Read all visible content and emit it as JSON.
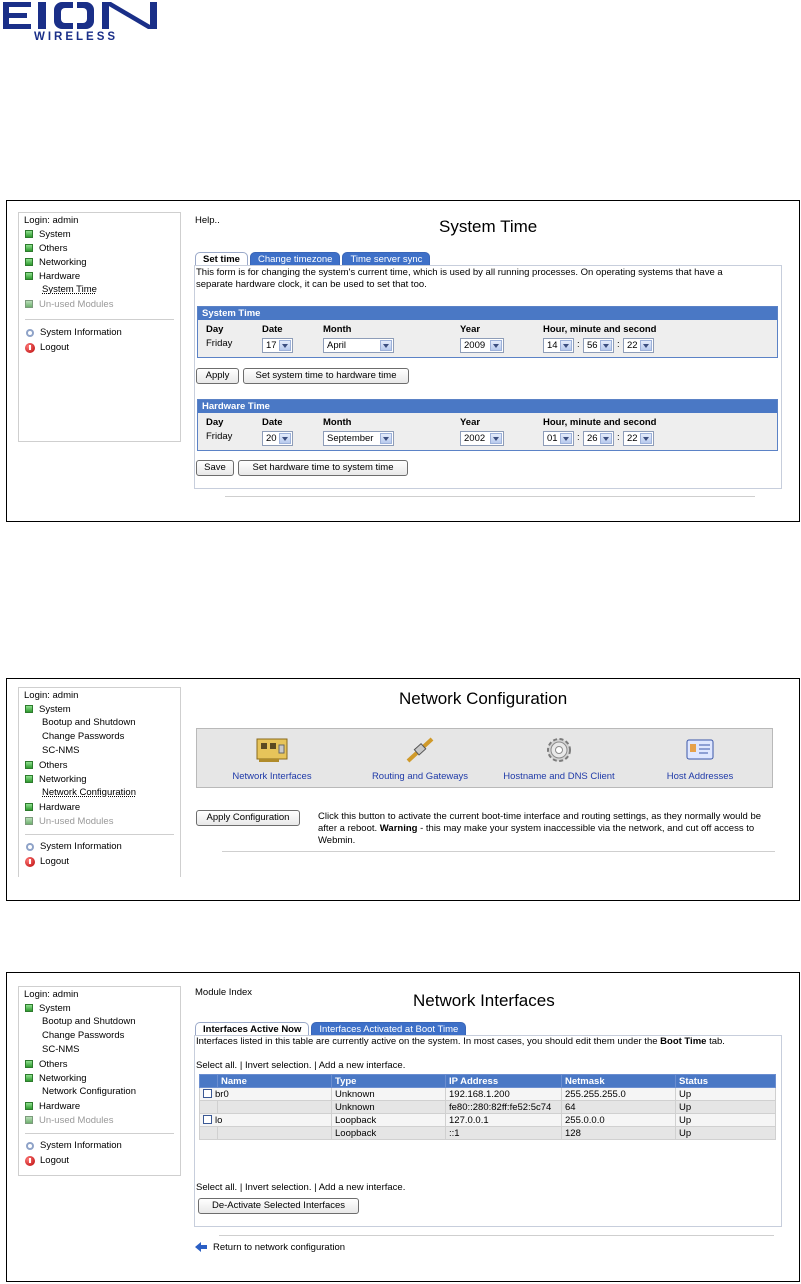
{
  "logo": {
    "mark": "EION",
    "text": "WIRELESS"
  },
  "menu1": {
    "login": "Login: admin",
    "items": [
      {
        "label": "System",
        "type": "cat"
      },
      {
        "label": "Others",
        "type": "cat"
      },
      {
        "label": "Networking",
        "type": "cat"
      },
      {
        "label": "Hardware",
        "type": "cat"
      },
      {
        "label": "System Time",
        "type": "sub"
      },
      {
        "label": "Un-used Modules",
        "type": "cat"
      }
    ],
    "sysinfo": "System Information",
    "logout": "Logout"
  },
  "system_time": {
    "help": "Help..",
    "title": "System Time",
    "tabs": [
      "Set time",
      "Change timezone",
      "Time server sync"
    ],
    "desc_line1": "This form is for changing the system's current time, which is used by all running processes. On operating systems that have a",
    "desc_line2": "separate hardware clock, it can be used to set that too.",
    "system": {
      "header": "System Time",
      "labels": {
        "day": "Day",
        "date": "Date",
        "month": "Month",
        "year": "Year",
        "hms": "Hour, minute and second"
      },
      "day": "Friday",
      "date": "17",
      "month": "April",
      "year": "2009",
      "hour": "14",
      "minute": "56",
      "second": "22"
    },
    "apply_label": "Apply",
    "set_hw_label": "Set system time to hardware time",
    "hardware": {
      "header": "Hardware Time",
      "labels": {
        "day": "Day",
        "date": "Date",
        "month": "Month",
        "year": "Year",
        "hms": "Hour, minute and second"
      },
      "day": "Friday",
      "date": "20",
      "month": "September",
      "year": "2002",
      "hour": "01",
      "minute": "26",
      "second": "22"
    },
    "save_label": "Save",
    "set_sys_label": "Set hardware time to system time"
  },
  "menu2": {
    "login": "Login: admin",
    "items": [
      {
        "label": "System",
        "type": "cat"
      },
      {
        "label": "Bootup and Shutdown",
        "type": "sub"
      },
      {
        "label": "Change Passwords",
        "type": "sub"
      },
      {
        "label": "SC-NMS",
        "type": "sub"
      },
      {
        "label": "Others",
        "type": "cat"
      },
      {
        "label": "Networking",
        "type": "cat"
      },
      {
        "label": "Network Configuration",
        "type": "sub"
      },
      {
        "label": "Hardware",
        "type": "cat"
      },
      {
        "label": "Un-used Modules",
        "type": "cat"
      }
    ],
    "sysinfo": "System Information",
    "logout": "Logout"
  },
  "network_config": {
    "title": "Network Configuration",
    "icons": [
      {
        "label": "Network Interfaces",
        "icon": "network-card-icon"
      },
      {
        "label": "Routing and Gateways",
        "icon": "cable-icon"
      },
      {
        "label": "Hostname and DNS Client",
        "icon": "gear-icon"
      },
      {
        "label": "Host Addresses",
        "icon": "address-card-icon"
      }
    ],
    "apply_label": "Apply Configuration",
    "apply_line1": "Click this button to activate the current boot-time interface and routing settings, as they normally would be",
    "apply_line2_pre": "after a reboot. ",
    "apply_warning": "Warning",
    "apply_line2_post": " - this may make your system inaccessible via the network, and cut off access to",
    "apply_line3": "Webmin."
  },
  "menu3": {
    "login": "Login: admin",
    "items": [
      {
        "label": "System",
        "type": "cat"
      },
      {
        "label": "Bootup and Shutdown",
        "type": "sub"
      },
      {
        "label": "Change Passwords",
        "type": "sub"
      },
      {
        "label": "SC-NMS",
        "type": "sub"
      },
      {
        "label": "Others",
        "type": "cat"
      },
      {
        "label": "Networking",
        "type": "cat"
      },
      {
        "label": "Network Configuration",
        "type": "sub"
      },
      {
        "label": "Hardware",
        "type": "cat"
      },
      {
        "label": "Un-used Modules",
        "type": "cat"
      }
    ],
    "sysinfo": "System Information",
    "logout": "Logout"
  },
  "interfaces": {
    "module_index": "Module Index",
    "title": "Network Interfaces",
    "tabs": [
      "Interfaces Active Now",
      "Interfaces Activated at Boot Time"
    ],
    "desc_pre": "Interfaces listed in this table are currently active on the system. In most cases, you should edit them under the ",
    "desc_bold": "Boot Time",
    "desc_post": " tab.",
    "select_all": "Select all.",
    "invert": "Invert selection.",
    "add_new": "Add a new interface.",
    "columns": [
      "Name",
      "Type",
      "IP Address",
      "Netmask",
      "Status"
    ],
    "rows": [
      {
        "name": "br0",
        "type": "Unknown",
        "ip": "192.168.1.200",
        "netmask": "255.255.255.0",
        "status": "Up"
      },
      {
        "name": "",
        "type": "Unknown",
        "ip": "fe80::280:82ff:fe52:5c74",
        "netmask": "64",
        "status": "Up"
      },
      {
        "name": "lo",
        "type": "Loopback",
        "ip": "127.0.0.1",
        "netmask": "255.0.0.0",
        "status": "Up"
      },
      {
        "name": "",
        "type": "Loopback",
        "ip": "::1",
        "netmask": "128",
        "status": "Up"
      }
    ],
    "deactivate_label": "De-Activate Selected Interfaces",
    "return_label": "Return to network configuration"
  }
}
